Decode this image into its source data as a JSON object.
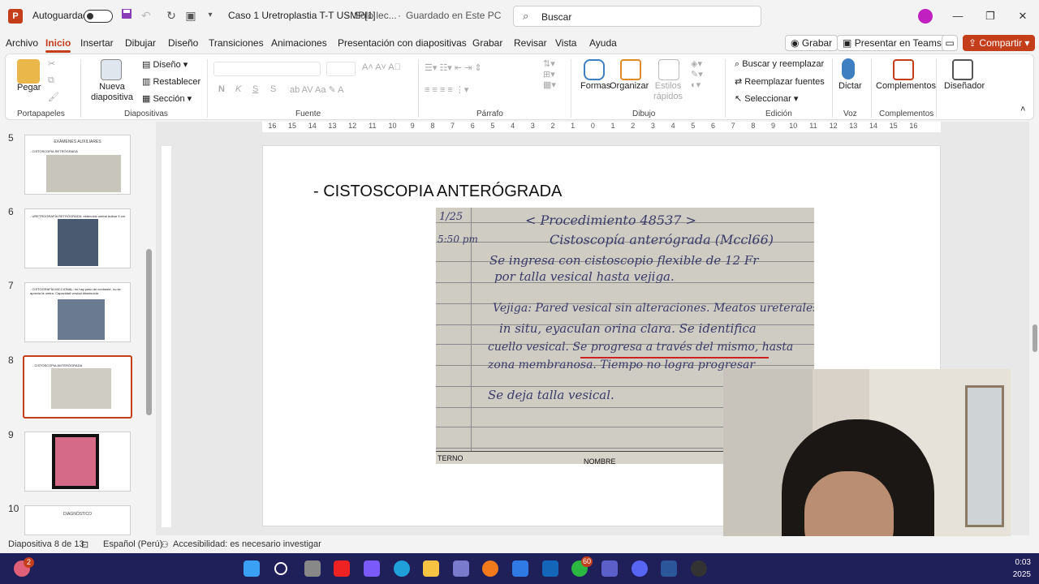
{
  "titlebar": {
    "autosave_label": "Autoguardado",
    "document_title": "Caso 1 Uretroplastia T-T USMP[1]",
    "save_state": "Solo lec...",
    "saved_location": "Guardado en Este PC",
    "search_placeholder": "Buscar",
    "app_icon": "P"
  },
  "menu": {
    "tabs": [
      "Archivo",
      "Inicio",
      "Insertar",
      "Dibujar",
      "Diseño",
      "Transiciones",
      "Animaciones",
      "Presentación con diapositivas",
      "Grabar",
      "Revisar",
      "Vista",
      "Ayuda"
    ],
    "active_tab": "Inicio",
    "record_button": "Grabar",
    "teams_button": "Presentar en Teams",
    "share_button": "Compartir"
  },
  "ribbon": {
    "paste": "Pegar",
    "new_slide": "Nueva diapositiva",
    "layout": "Diseño",
    "reset": "Restablecer",
    "section": "Sección",
    "font_buttons": [
      "N",
      "K",
      "S",
      "S"
    ],
    "shapes": "Formas",
    "arrange": "Organizar",
    "quick_styles": "Estilos rápidos",
    "find_replace": "Buscar y reemplazar",
    "replace_fonts": "Reemplazar fuentes",
    "select": "Seleccionar",
    "dictate": "Dictar",
    "addins": "Complementos",
    "designer": "Diseñador",
    "groups": {
      "clipboard": "Portapapeles",
      "slides": "Diapositivas",
      "font": "Fuente",
      "paragraph": "Párrafo",
      "drawing": "Dibujo",
      "editing": "Edición",
      "voice": "Voz",
      "addins": "Complementos"
    }
  },
  "thumbnails": [
    {
      "number": "5",
      "title": "EXÁMENES AUXILIARES",
      "caption": "- CISTOSCOPIA RETRÓGRADA",
      "selected": false
    },
    {
      "number": "6",
      "title": "",
      "caption": "- URETROGRAFÍA RETRÓGRADA: estenosis uretral bulbar 3 cm",
      "selected": false
    },
    {
      "number": "7",
      "title": "",
      "caption": "- CISTOGRAFÍA MICCIONAL: no hay paso de contraste, no se aprecia la uretra. Capacidad vesical disminuida.",
      "selected": false
    },
    {
      "number": "8",
      "title": "",
      "caption": "- CISTOSCOPIA ANTERÓGRADA",
      "selected": true
    },
    {
      "number": "9",
      "title": "",
      "caption": "",
      "selected": false
    },
    {
      "number": "10",
      "title": "DIAGNÓSTICO",
      "caption": "",
      "selected": false
    }
  ],
  "ruler": {
    "ticks": [
      "16",
      "15",
      "14",
      "13",
      "12",
      "11",
      "10",
      "9",
      "8",
      "7",
      "6",
      "5",
      "4",
      "3",
      "2",
      "1",
      "0",
      "1",
      "2",
      "3",
      "4",
      "5",
      "6",
      "7",
      "8",
      "9",
      "10",
      "11",
      "12",
      "13",
      "14",
      "15",
      "16"
    ]
  },
  "slide": {
    "title": "- CISTOSCOPIA ANTERÓGRADA",
    "note_lines": [
      "1/25",
      "< Procedimiento 48537 >",
      "Cistoscopía anterógrada (Mccl66)",
      "5:50 pm",
      "Se ingresa con cistoscopio flexible de 12 Fr",
      "por talla vesical hasta vejiga.",
      "Vejiga: Pared vesical sin alteraciones. Meatos ureterales",
      "in situ, eyaculan orina clara. Se identifica",
      "cuello vesical. Se progresa a través del mismo, hasta",
      "zona membranosa. Tiempo no logra progresar",
      "Se deja talla vesical.",
      "TERNO",
      "NOMBRE"
    ]
  },
  "status": {
    "slide_info": "Diapositiva 8 de 13",
    "language": "Español (Perú)",
    "accessibility": "Accesibilidad: es necesario investigar"
  },
  "taskbar": {
    "time": "0:03",
    "year": "2025",
    "whatsapp_badge": "60",
    "notification_badge": "2"
  },
  "colors": {
    "accent": "#c43e1c",
    "taskbar": "#1f1f5a",
    "avatar": "#c020c0"
  }
}
